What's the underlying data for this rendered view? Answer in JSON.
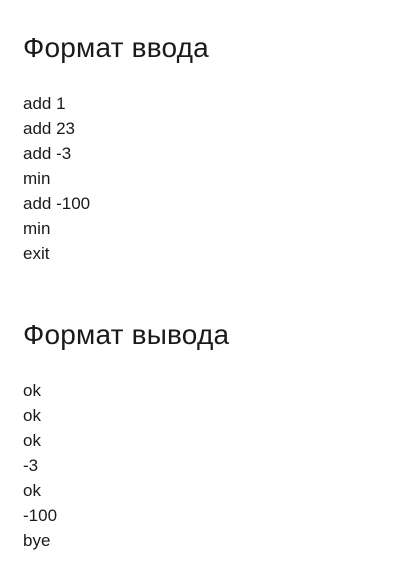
{
  "input": {
    "title": "Формат ввода",
    "lines": [
      "add 1",
      "add 23",
      "add -3",
      "min",
      "add -100",
      "min",
      "exit"
    ]
  },
  "output": {
    "title": "Формат вывода",
    "lines": [
      "ok",
      "ok",
      "ok",
      "-3",
      "ok",
      "-100",
      "bye"
    ]
  }
}
